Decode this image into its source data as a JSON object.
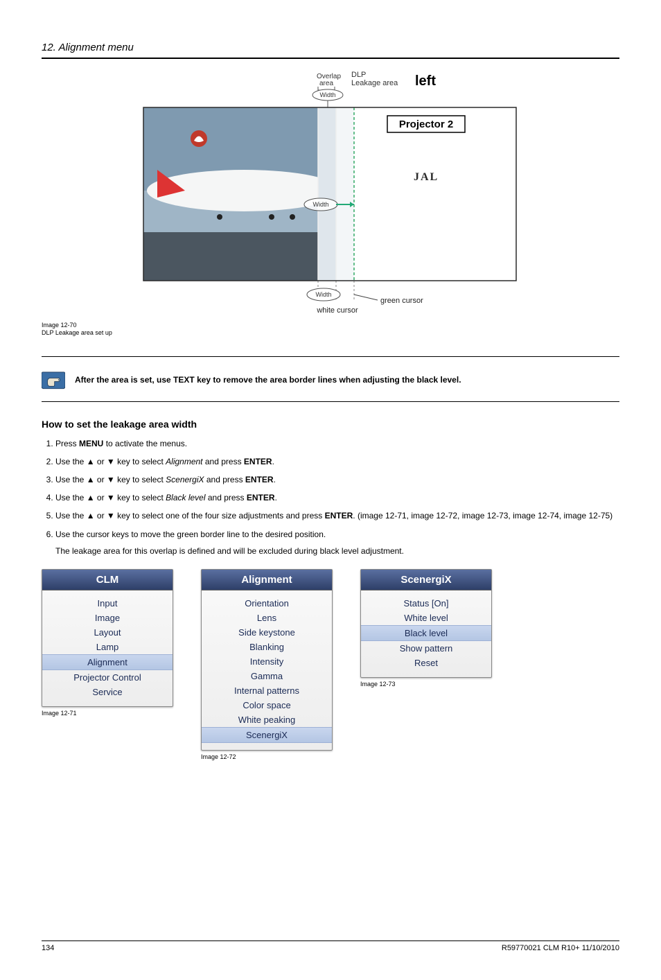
{
  "chapter_title": "12. Alignment menu",
  "figure_main": {
    "label_overlap": "Overlap",
    "label_overlap2": "area",
    "label_dlp": "DLP",
    "label_dlpleak": "Leakage area",
    "label_left": "left",
    "label_projector2": "Projector 2",
    "label_width": "Width",
    "label_green_cursor": "green cursor",
    "label_white_cursor": "white cursor",
    "caption_id": "Image 12-70",
    "caption_desc": "DLP Leakage area set up"
  },
  "note_text": "After the area is set, use TEXT key to remove the area border lines when adjusting the black level.",
  "section_heading": "How to set the leakage area width",
  "steps": [
    {
      "pre": "Press ",
      "b1": "MENU",
      "post": " to activate the menus."
    },
    {
      "pre": "Use the ▲ or ▼ key to select ",
      "i1": "Alignment",
      "mid": " and press ",
      "b1": "ENTER",
      "post": "."
    },
    {
      "pre": "Use the ▲ or ▼ key to select ",
      "i1": "ScenergiX",
      "mid": " and press ",
      "b1": "ENTER",
      "post": "."
    },
    {
      "pre": "Use the ▲ or ▼ key to select ",
      "i1": "Black level",
      "mid": " and press ",
      "b1": "ENTER",
      "post": "."
    },
    {
      "pre": "Use the ▲ or ▼ key to select one of the four size adjustments and press ",
      "b1": "ENTER",
      "post": ". (image 12-71, image 12-72, image 12-73, image 12-74, image 12-75)"
    },
    {
      "pre": "Use the cursor keys to move the green border line to the desired position.",
      "extra": "The leakage area for this overlap is defined and will be excluded during black level adjustment."
    }
  ],
  "menus": {
    "clm": {
      "title": "CLM",
      "items": [
        "Input",
        "Image",
        "Layout",
        "Lamp",
        "Alignment",
        "Projector Control",
        "Service"
      ],
      "highlight_index": 4,
      "caption": "Image 12-71"
    },
    "alignment": {
      "title": "Alignment",
      "items": [
        "Orientation",
        "Lens",
        "Side keystone",
        "Blanking",
        "Intensity",
        "Gamma",
        "Internal patterns",
        "Color space",
        "White peaking",
        "ScenergiX"
      ],
      "highlight_index": 9,
      "caption": "Image 12-72"
    },
    "scenergix": {
      "title": "ScenergiX",
      "items": [
        "Status [On]",
        "White level",
        "Black level",
        "Show pattern",
        "Reset"
      ],
      "highlight_index": 2,
      "caption": "Image 12-73"
    }
  },
  "footer": {
    "page": "134",
    "doc": "R59770021 CLM R10+ 11/10/2010"
  }
}
